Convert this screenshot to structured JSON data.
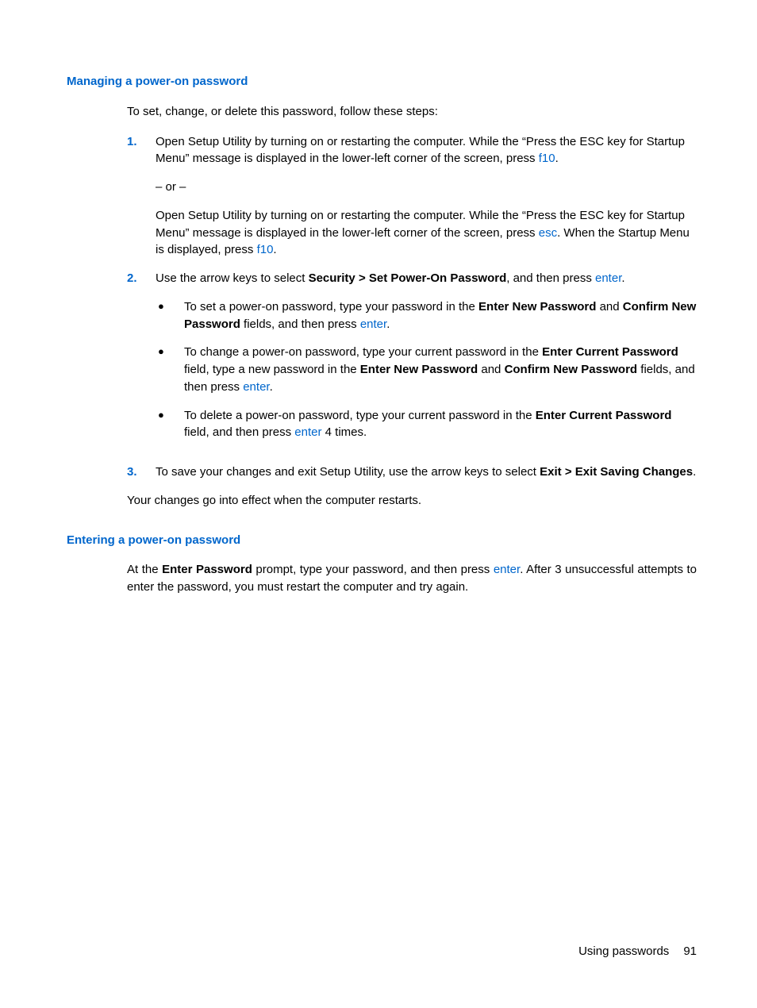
{
  "section1": {
    "heading": "Managing a power-on password",
    "intro": "To set, change, or delete this password, follow these steps:",
    "step1": {
      "marker": "1.",
      "p1_a": "Open Setup Utility by turning on or restarting the computer. While the “Press the ESC key for Startup Menu” message is displayed in the lower-left corner of the screen, press ",
      "p1_key1": "f10",
      "p1_b": ".",
      "or": "– or –",
      "p2_a": "Open Setup Utility by turning on or restarting the computer. While the “Press the ESC key for Startup Menu” message is displayed in the lower-left corner of the screen, press ",
      "p2_key1": "esc",
      "p2_b": ". When the Startup Menu is displayed, press ",
      "p2_key2": "f10",
      "p2_c": "."
    },
    "step2": {
      "marker": "2.",
      "line_a": "Use the arrow keys to select ",
      "line_bold": "Security > Set Power-On Password",
      "line_b": ", and then press ",
      "line_key": "enter",
      "line_c": ".",
      "bullets": {
        "b1": {
          "a": "To set a power-on password, type your password in the ",
          "bold1": "Enter New Password",
          "b": " and ",
          "bold2": "Confirm New Password",
          "c": " fields, and then press ",
          "key": "enter",
          "d": "."
        },
        "b2": {
          "a": "To change a power-on password, type your current password in the ",
          "bold1": "Enter Current Password",
          "b": " field, type a new password in the ",
          "bold2": "Enter New Password",
          "c": " and ",
          "bold3": "Confirm New Password",
          "d": " fields, and then press ",
          "key": "enter",
          "e": "."
        },
        "b3": {
          "a": "To delete a power-on password, type your current password in the ",
          "bold1": "Enter Current Password",
          "b": " field, and then press ",
          "key": "enter",
          "c": " 4 times."
        }
      }
    },
    "step3": {
      "marker": "3.",
      "a": "To save your changes and exit Setup Utility, use the arrow keys to select ",
      "bold": "Exit > Exit Saving Changes",
      "b": "."
    },
    "closing": "Your changes go into effect when the computer restarts."
  },
  "section2": {
    "heading": "Entering a power-on password",
    "body": {
      "a": "At the ",
      "bold": "Enter Password",
      "b": " prompt, type your password, and then press ",
      "key": "enter",
      "c": ". After 3 unsuccessful attempts to enter the password, you must restart the computer and try again."
    }
  },
  "footer": {
    "label": "Using passwords",
    "page": "91"
  }
}
